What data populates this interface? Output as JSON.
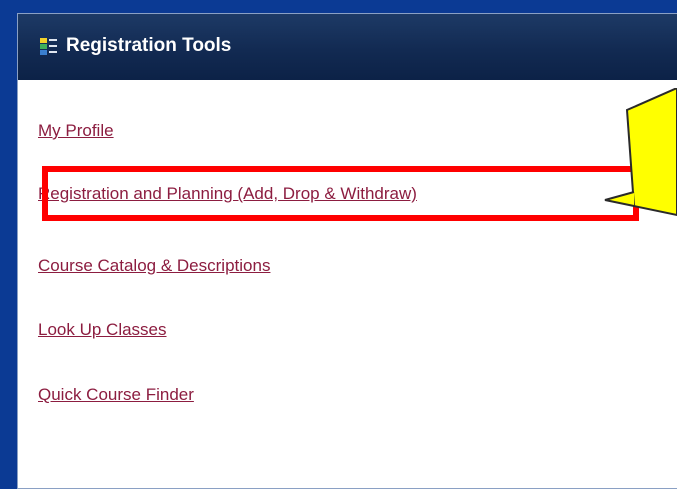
{
  "panel": {
    "title": "Registration Tools",
    "header_icon": "menu-list-icon"
  },
  "links": [
    {
      "label": "My Profile"
    },
    {
      "label": "Registration and Planning (Add, Drop & Withdraw)"
    },
    {
      "label": "Course Catalog & Descriptions"
    },
    {
      "label": "Look Up Classes"
    },
    {
      "label": "Quick Course Finder"
    }
  ],
  "annotations": {
    "highlight_color": "#ff0000",
    "callout_color": "#ffff00"
  },
  "colors": {
    "background": "#0b3a94",
    "header": "#122a52",
    "link": "#8c1d40"
  }
}
